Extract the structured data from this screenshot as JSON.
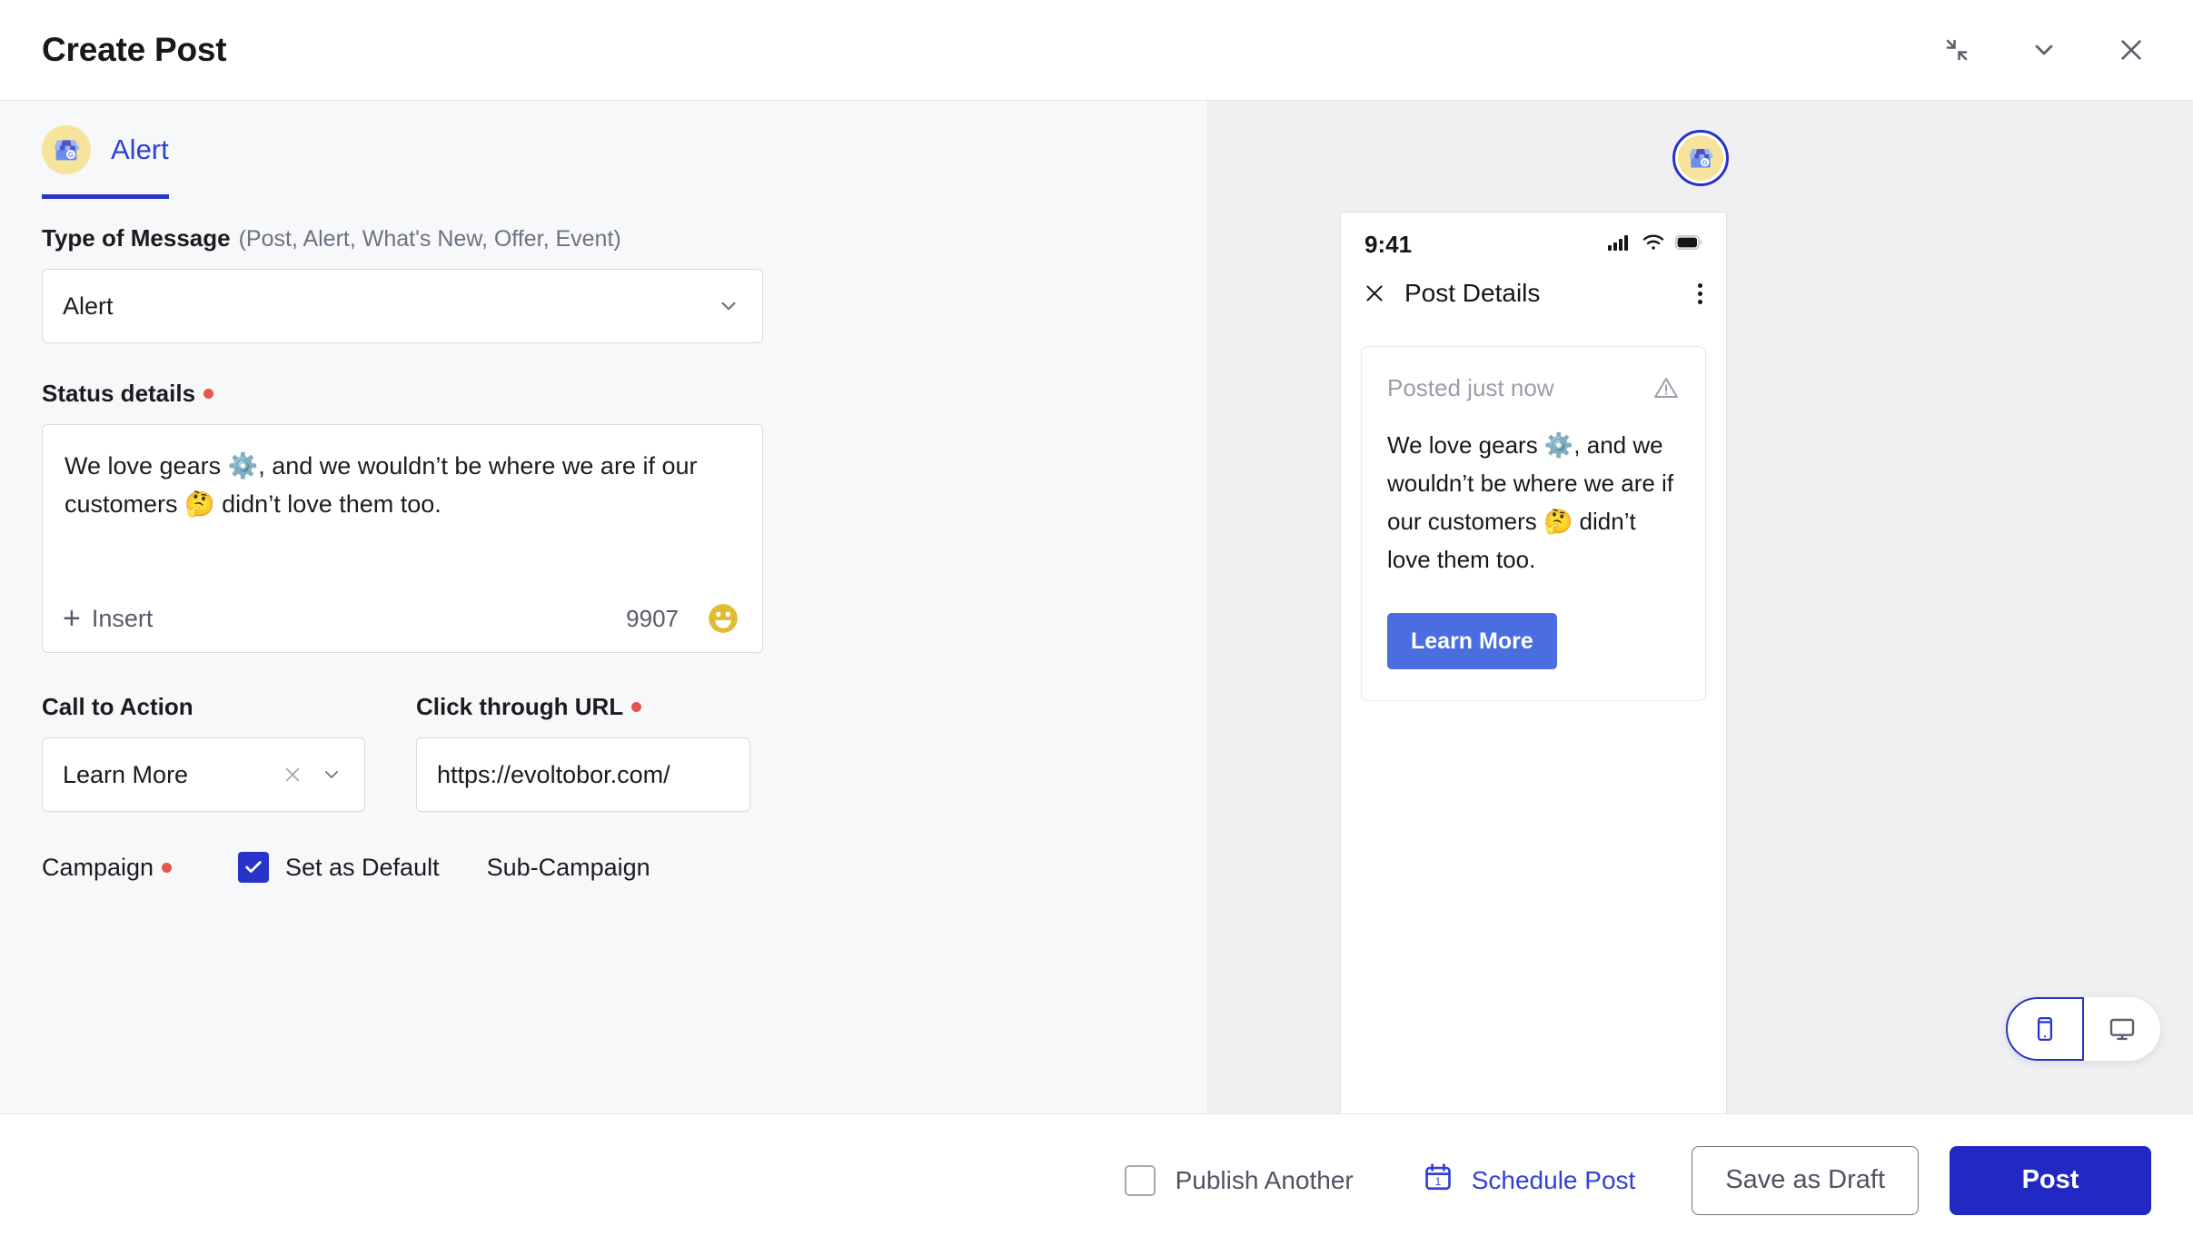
{
  "window": {
    "title": "Create Post",
    "actions": [
      {
        "name": "collapse-icon",
        "label": "Collapse"
      },
      {
        "name": "chevron-down-icon",
        "label": "Minimize"
      },
      {
        "name": "close-icon",
        "label": "Close"
      }
    ]
  },
  "editor": {
    "tab": {
      "label": "Alert",
      "icon": "google-business-profile-icon"
    },
    "message_type": {
      "label": "Type of Message",
      "hint": "(Post, Alert, What's New, Offer, Event)",
      "value": "Alert"
    },
    "status_details": {
      "label": "Status details",
      "required": true,
      "value": "We love gears ⚙️, and we wouldn’t be where we are if our customers 🤔 didn’t love them too.",
      "insert_label": "Insert",
      "char_count": "9907",
      "emoji_button": "😃"
    },
    "call_to_action": {
      "label": "Call to Action",
      "value": "Learn More"
    },
    "click_through_url": {
      "label": "Click through URL",
      "required": true,
      "value": "https://evoltobor.com/"
    },
    "campaign": {
      "label": "Campaign",
      "required": true
    },
    "set_as_default": {
      "label": "Set as Default",
      "checked": true
    },
    "sub_campaign": {
      "label": "Sub-Campaign"
    }
  },
  "preview": {
    "status_bar": {
      "time": "9:41"
    },
    "header": {
      "title": "Post Details"
    },
    "card": {
      "posted_label": "Posted just now",
      "body": "We love gears ⚙️, and we wouldn’t be where we are if our customers 🤔 didn’t love them too.",
      "cta_label": "Learn More"
    },
    "device_toggle": {
      "mobile_label": "Mobile",
      "desktop_label": "Desktop",
      "active": "mobile"
    }
  },
  "footer": {
    "publish_another": {
      "label": "Publish Another",
      "checked": false
    },
    "schedule_post": {
      "label": "Schedule Post"
    },
    "save_draft": {
      "label": "Save as Draft"
    },
    "post": {
      "label": "Post"
    }
  },
  "colors": {
    "brand_blue": "#2733c9",
    "post_button": "#2128c4",
    "link_blue": "#2f41d8",
    "cta_blue": "#4a6ee0",
    "required_dot": "#e2574c",
    "editor_bg": "#f7f8fa",
    "preview_bg": "#f0f0f2"
  }
}
